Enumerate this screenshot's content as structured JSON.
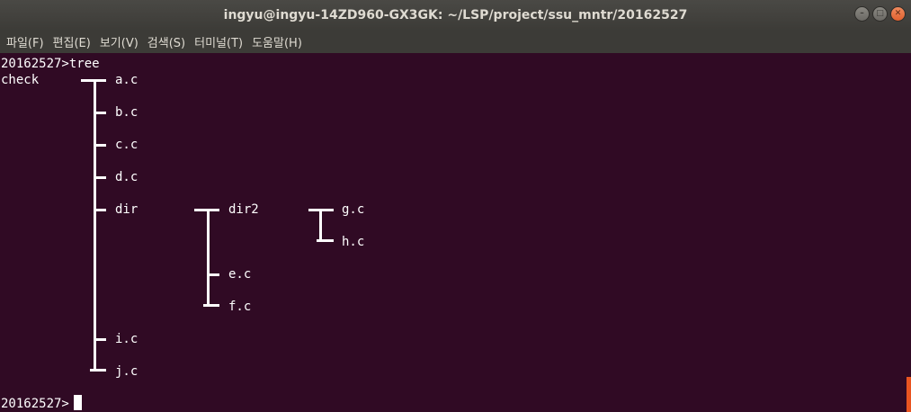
{
  "window": {
    "title": "ingyu@ingyu-14ZD960-GX3GK: ~/LSP/project/ssu_mntr/20162527"
  },
  "menu": [
    {
      "label": "파일(F)"
    },
    {
      "label": "편집(E)"
    },
    {
      "label": "보기(V)"
    },
    {
      "label": "검색(S)"
    },
    {
      "label": "터미널(T)"
    },
    {
      "label": "도움말(H)"
    }
  ],
  "terminal": {
    "command_line": "20162527>tree",
    "root": "check",
    "level1": [
      "a.c",
      "b.c",
      "c.c",
      "d.c",
      "dir",
      "i.c",
      "j.c"
    ],
    "level2": [
      "dir2",
      "e.c",
      "f.c"
    ],
    "level3": [
      "g.c",
      "h.c"
    ],
    "prompt": "20162527>"
  },
  "colors": {
    "background": "#300a24",
    "text": "#ffffff",
    "accent": "#e95420"
  }
}
